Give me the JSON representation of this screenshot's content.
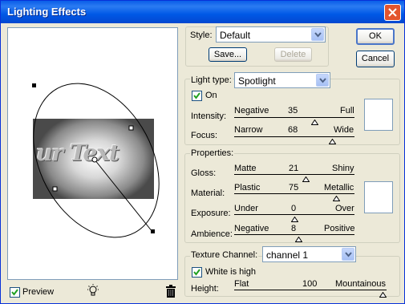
{
  "window": {
    "title": "Lighting Effects"
  },
  "style": {
    "label": "Style:",
    "value": "Default",
    "save_label": "Save...",
    "delete_label": "Delete"
  },
  "buttons": {
    "ok": "OK",
    "cancel": "Cancel"
  },
  "light": {
    "type_label": "Light type:",
    "type_value": "Spotlight",
    "on_label": "On",
    "on_checked": true,
    "intensity": {
      "label": "Intensity:",
      "min_label": "Negative",
      "value": "35",
      "max_label": "Full",
      "fraction": 0.68
    },
    "focus": {
      "label": "Focus:",
      "min_label": "Narrow",
      "value": "68",
      "max_label": "Wide",
      "fraction": 0.84
    }
  },
  "properties": {
    "title": "Properties:",
    "gloss": {
      "label": "Gloss:",
      "min_label": "Matte",
      "value": "21",
      "max_label": "Shiny",
      "fraction": 0.6
    },
    "material": {
      "label": "Material:",
      "min_label": "Plastic",
      "value": "75",
      "max_label": "Metallic",
      "fraction": 0.87
    },
    "exposure": {
      "label": "Exposure:",
      "min_label": "Under",
      "value": "0",
      "max_label": "Over",
      "fraction": 0.5
    },
    "ambience": {
      "label": "Ambience:",
      "min_label": "Negative",
      "value": "8",
      "max_label": "Positive",
      "fraction": 0.54
    }
  },
  "texture": {
    "channel_label": "Texture Channel:",
    "channel_value": "channel 1",
    "white_high_label": "White is high",
    "white_high_checked": true,
    "height": {
      "label": "Height:",
      "min_label": "Flat",
      "value": "100",
      "max_label": "Mountainous",
      "fraction": 1.0
    }
  },
  "preview": {
    "label": "Preview",
    "checked": true,
    "image_text": "ur Text"
  },
  "colors": {
    "title_bar": "#0058e6",
    "face": "#ece9d8",
    "close": "#e3552e"
  }
}
